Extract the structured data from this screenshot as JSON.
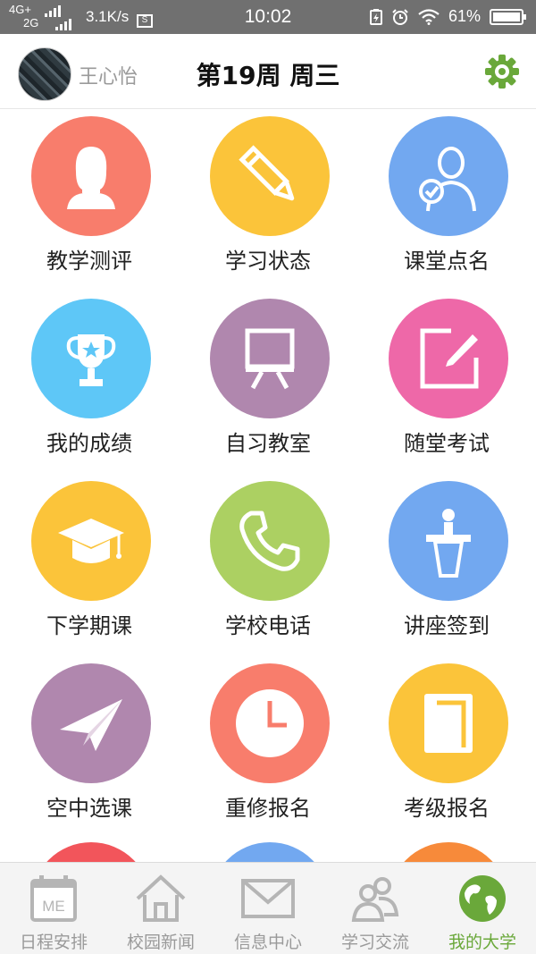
{
  "status_bar": {
    "network_top": "4G+",
    "network_bottom": "2G",
    "speed": "3.1K/s",
    "time": "10:02",
    "battery": "61%",
    "battery_level": 0.61
  },
  "header": {
    "username": "王心怡",
    "week": "第19周 周三",
    "settings_icon": "gear-icon",
    "accent_color": "#6aa83a"
  },
  "grid": {
    "items": [
      {
        "label": "教学测评",
        "icon": "female-person-icon",
        "color": "#f87d6c"
      },
      {
        "label": "学习状态",
        "icon": "pencil-icon",
        "color": "#fbc43a"
      },
      {
        "label": "课堂点名",
        "icon": "person-check-icon",
        "color": "#72a8f0"
      },
      {
        "label": "我的成绩",
        "icon": "trophy-icon",
        "color": "#5ec7f7"
      },
      {
        "label": "自习教室",
        "icon": "easel-board-icon",
        "color": "#b087ae"
      },
      {
        "label": "随堂考试",
        "icon": "edit-square-icon",
        "color": "#ee68a8"
      },
      {
        "label": "下学期课",
        "icon": "graduation-cap-icon",
        "color": "#fbc43a"
      },
      {
        "label": "学校电话",
        "icon": "phone-icon",
        "color": "#acd062"
      },
      {
        "label": "讲座签到",
        "icon": "podium-icon",
        "color": "#72a8f0"
      },
      {
        "label": "空中选课",
        "icon": "paper-plane-icon",
        "color": "#b087ae"
      },
      {
        "label": "重修报名",
        "icon": "clock-icon",
        "color": "#f87d6c"
      },
      {
        "label": "考级报名",
        "icon": "book-icon",
        "color": "#fbc43a"
      }
    ],
    "partial_row_colors": [
      "#f2555b",
      "#72a8f0",
      "#f78a3a"
    ]
  },
  "bottom_nav": {
    "items": [
      {
        "label": "日程安排",
        "icon": "calendar-me-icon",
        "active": false
      },
      {
        "label": "校园新闻",
        "icon": "home-icon",
        "active": false
      },
      {
        "label": "信息中心",
        "icon": "mail-icon",
        "active": false
      },
      {
        "label": "学习交流",
        "icon": "people-icon",
        "active": false
      },
      {
        "label": "我的大学",
        "icon": "globe-icon",
        "active": true
      }
    ],
    "calendar_text": "ME"
  }
}
